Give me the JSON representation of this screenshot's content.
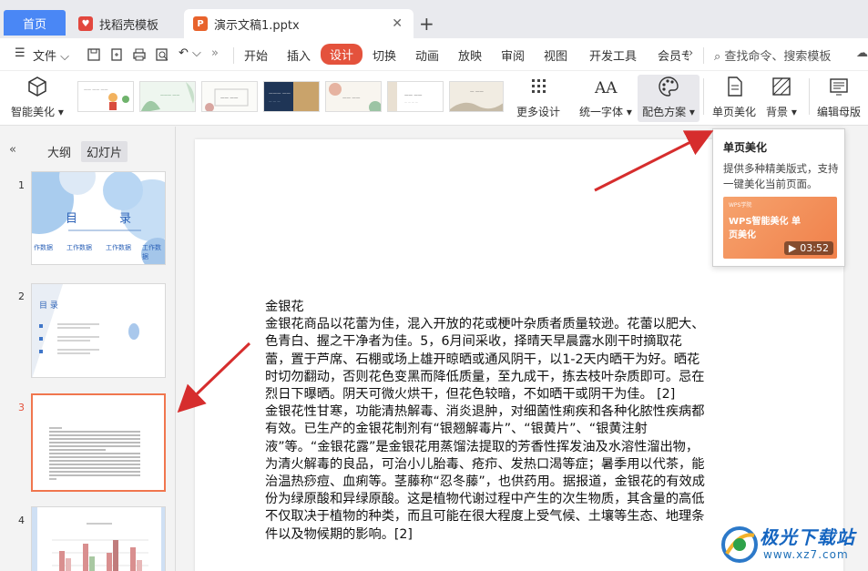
{
  "tabs": [
    {
      "label": "首页"
    },
    {
      "label": "找稻壳模板"
    },
    {
      "label": "演示文稿1.pptx"
    }
  ],
  "menubar": {
    "file_label": "文件",
    "items": [
      "开始",
      "插入",
      "设计",
      "切换",
      "动画",
      "放映",
      "审阅",
      "视图",
      "开发工具",
      "会员专"
    ],
    "active": "设计",
    "search_label": "查找命令、搜索模板"
  },
  "ribbon": {
    "smart_beautify": "智能美化",
    "more_design": "更多设计",
    "unify_font": "统一字体",
    "color_scheme": "配色方案",
    "single_page_beautify": "单页美化",
    "background": "背景",
    "edit_master": "编辑母版"
  },
  "leftpane": {
    "tab_outline": "大纲",
    "tab_slides": "幻灯片",
    "slides": [
      {
        "num": "1",
        "title_a": "目",
        "title_b": "录",
        "items": [
          "作数据",
          "工作数据",
          "工作数据",
          "工作数据"
        ]
      },
      {
        "num": "2",
        "title": "目 录"
      },
      {
        "num": "3"
      },
      {
        "num": "4"
      }
    ]
  },
  "document": {
    "paragraphs": [
      "金银花",
      "金银花商品以花蕾为佳，混入开放的花或梗叶杂质者质量较逊。花蕾以肥大、色青白、握之干净者为佳。5，6月间采收，择晴天早晨露水刚干时摘取花蕾，置于芦席、石棚或场上雄开晾晒或通风阴干，以1-2天内晒干为好。晒花时切勿翻动，否则花色变黑而降低质量，至九成干，拣去枝叶杂质即可。忌在烈日下曝晒。阴天可微火烘干，但花色较暗，不如晒干或阴干为佳。 [2]",
      "金银花性甘寒，功能清热解毒、消炎退肿，对细菌性痢疾和各种化脓性疾病都有效。已生产的金银花制剂有“银翘解毒片”、“银黄片”、“银黄注射液”等。“金银花露”是金银花用蒸馏法提取的芳香性挥发油及水溶性溜出物，为清火解毒的良品，可治小儿胎毒、疮疖、发热口渴等症；暑季用以代茶，能治温热痧痘、血痢等。茎藤称“忍冬藤”，也供药用。据报道，金银花的有效成份为绿原酸和异绿原酸。这是植物代谢过程中产生的次生物质，其含量的高低不仅取决于植物的种类，而且可能在很大程度上受气候、土壤等生态、地理条件以及物候期的影响。[2]"
    ]
  },
  "tooltip": {
    "title": "单页美化",
    "description": "提供多种精美版式，支持一键美化当前页面。",
    "video_small": "WPS学院",
    "video_title": "WPS智能美化 单页美化",
    "duration": "03:52"
  },
  "watermark": {
    "name": "极光下载站",
    "url": "www.xz7.com"
  },
  "colors": {
    "accent": "#e4523c",
    "home_tab": "#4a87f5",
    "arrow": "#d62d2d",
    "current_slide_border": "#f0764e"
  }
}
